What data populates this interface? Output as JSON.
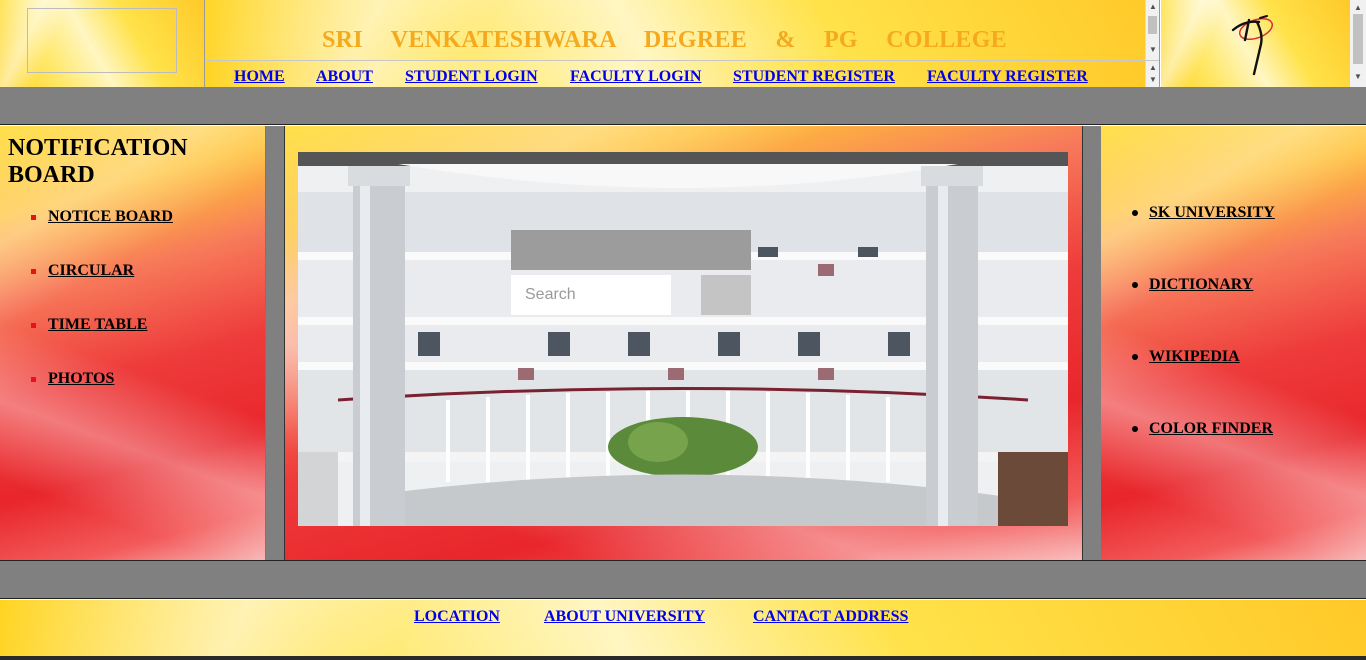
{
  "header": {
    "college_title": "SRI VENKATESHWARA DEGREE & PG COLLEGE",
    "nav": [
      "HOME",
      "ABOUT",
      "STUDENT LOGIN",
      "FACULTY LOGIN",
      "STUDENT REGISTER",
      "FACULTY REGISTER"
    ]
  },
  "left_panel": {
    "heading": "NOTIFICATION BOARD",
    "links": [
      "NOTICE BOARD",
      "CIRCULAR",
      "TIME TABLE",
      "PHOTOS"
    ]
  },
  "center": {
    "search_placeholder": "Search"
  },
  "right_panel": {
    "links": [
      "SK UNIVERSITY",
      "DICTIONARY",
      "WIKIPEDIA",
      "COLOR FINDER"
    ]
  },
  "footer": {
    "links": [
      "LOCATION",
      "ABOUT UNIVERSITY",
      "CANTACT ADDRESS"
    ]
  },
  "colors": {
    "title": "#f4a91e",
    "nav_link": "#0000ee",
    "band": "#808080",
    "bullet": "#e8121a"
  },
  "icons": {
    "broken_image": "broken-image-icon",
    "signature_logo": "signature-logo-icon"
  }
}
